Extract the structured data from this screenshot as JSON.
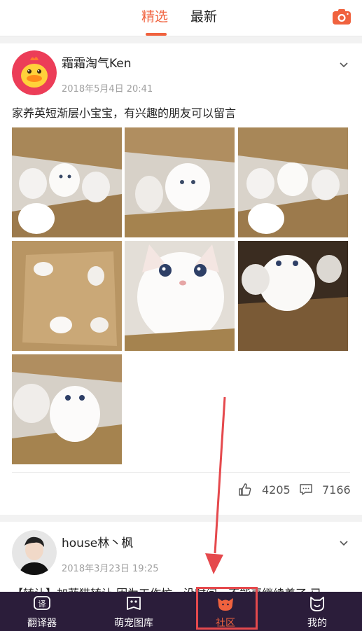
{
  "header": {
    "tabs": [
      {
        "label": "精选",
        "active": true
      },
      {
        "label": "最新",
        "active": false
      }
    ],
    "accent_color": "#f0623e",
    "right_icon": "camera-icon"
  },
  "posts": [
    {
      "username": "霜霜淘气Ken",
      "time": "2018年5月4日 20:41",
      "text": "家养英短渐层小宝宝，有兴趣的朋友可以留言",
      "photo_count": 7,
      "likes": "4205",
      "comments": "7166"
    },
    {
      "username": "house林丶枫",
      "time": "2018年3月23日 19:25",
      "text": "【转让】加菲猫转让 因为工作忙，没时间，不能再继续养了 已"
    }
  ],
  "bottom_nav": {
    "items": [
      {
        "label": "翻译器",
        "icon": "translator-icon"
      },
      {
        "label": "萌宠图库",
        "icon": "gallery-icon"
      },
      {
        "label": "社区",
        "icon": "community-cat-icon",
        "active": true
      },
      {
        "label": "我的",
        "icon": "profile-icon"
      }
    ],
    "background": "#2b1d3a"
  },
  "annotation_color": "#e5494d"
}
